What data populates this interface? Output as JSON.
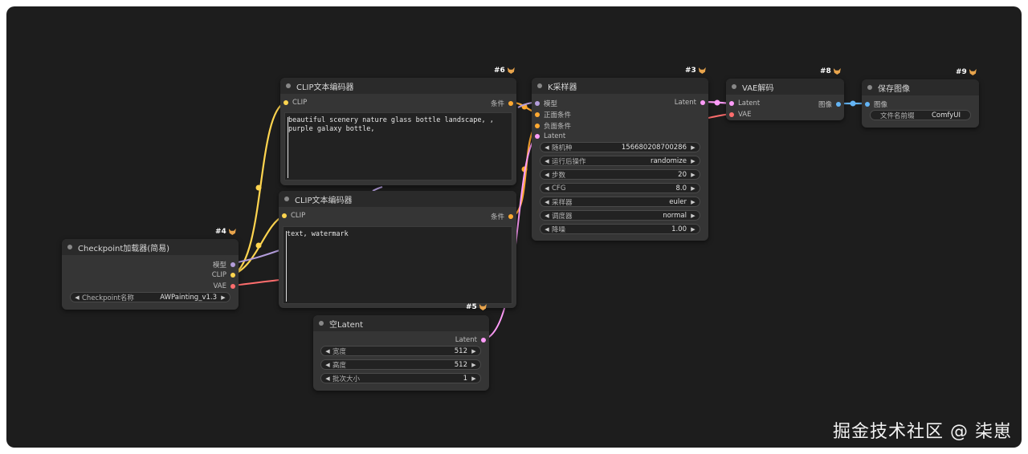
{
  "colors": {
    "model": "#b39ddb",
    "clip": "#ffd54f",
    "vae": "#ff6e6e",
    "conditioning": "#ffa931",
    "latent": "#ff9cf9",
    "image": "#64b5f6"
  },
  "nodes": {
    "n6": {
      "badge": "#6",
      "title": "CLIP文本编码器",
      "input_clip": "CLIP",
      "output_cond": "条件",
      "text": "beautiful scenery nature glass bottle landscape, ,\npurple galaxy bottle,"
    },
    "n7": {
      "title": "CLIP文本编码器",
      "input_clip": "CLIP",
      "output_cond": "条件",
      "text": "text, watermark"
    },
    "n4": {
      "badge": "#4",
      "title": "Checkpoint加载器(简易)",
      "out_model": "模型",
      "out_clip": "CLIP",
      "out_vae": "VAE",
      "widget_label": "Checkpoint名称",
      "widget_value": "AWPainting_v1.3"
    },
    "n3": {
      "badge": "#3",
      "title": "K采样器",
      "in_model": "模型",
      "in_positive": "正面条件",
      "in_negative": "负面条件",
      "in_latent": "Latent",
      "out_latent": "Latent",
      "widgets": [
        {
          "label": "随机种",
          "value": "156680208700286"
        },
        {
          "label": "运行后操作",
          "value": "randomize"
        },
        {
          "label": "步数",
          "value": "20"
        },
        {
          "label": "CFG",
          "value": "8.0"
        },
        {
          "label": "采样器",
          "value": "euler"
        },
        {
          "label": "调度器",
          "value": "normal"
        },
        {
          "label": "降噪",
          "value": "1.00"
        }
      ]
    },
    "n5": {
      "badge": "#5",
      "title": "空Latent",
      "out_latent": "Latent",
      "widgets": [
        {
          "label": "宽度",
          "value": "512"
        },
        {
          "label": "高度",
          "value": "512"
        },
        {
          "label": "批次大小",
          "value": "1"
        }
      ]
    },
    "n8": {
      "badge": "#8",
      "title": "VAE解码",
      "in_latent": "Latent",
      "in_vae": "VAE",
      "out_image": "图像"
    },
    "n9": {
      "badge": "#9",
      "title": "保存图像",
      "in_image": "图像",
      "widget_label": "文件名前缀",
      "widget_value": "ComfyUI"
    }
  },
  "watermark": "掘金技术社区 @ 柒崽"
}
